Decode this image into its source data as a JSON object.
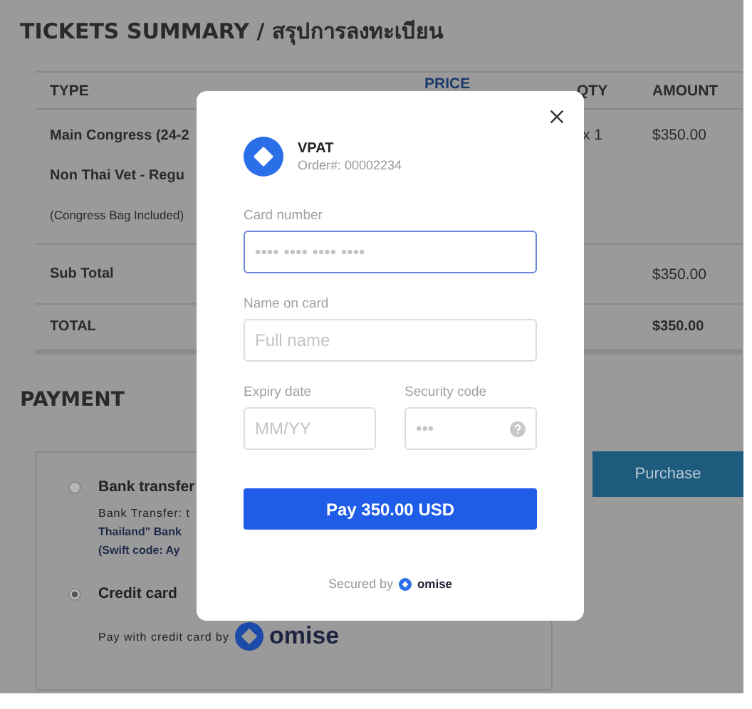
{
  "page": {
    "title": "TICKETS SUMMARY / สรุปการลงทะเบียน",
    "table": {
      "columns": [
        "TYPE",
        "PRICE",
        "QTY",
        "AMOUNT"
      ],
      "rows": [
        {
          "kind": "item",
          "type": "Main Congress (24-2",
          "qty": "x 1",
          "amount": "$350.00"
        },
        {
          "kind": "item",
          "type": "Non Thai Vet - Regu"
        },
        {
          "kind": "note",
          "type": "(Congress Bag Included)"
        }
      ],
      "subtotal": {
        "label": "Sub Total",
        "amount": "$350.00"
      },
      "total": {
        "label": "TOTAL",
        "amount": "$350.00"
      }
    },
    "payment": {
      "heading": "PAYMENT",
      "options": [
        {
          "label": "Bank transfer",
          "selected": false,
          "details": [
            {
              "text": "Bank Transfer: t",
              "bold": false
            },
            {
              "text": "Thailand\" Bank",
              "bold": true
            },
            {
              "text": "(Swift code: Ay",
              "bold": true
            }
          ]
        },
        {
          "label": "Credit card",
          "selected": true,
          "details": [
            {
              "text": "Pay with credit card by",
              "bold": false
            }
          ],
          "brand": "omise"
        }
      ],
      "purchase_button": "Purchase"
    }
  },
  "modal": {
    "merchant": "VPAT",
    "order": "Order#: 00002234",
    "fields": [
      {
        "label": "Card number",
        "placeholder": "•••• •••• •••• ••••",
        "focused": true,
        "kind": "wide"
      },
      {
        "label": "Name on card",
        "placeholder": "Full name",
        "focused": false,
        "kind": "wide"
      },
      {
        "label": "Expiry date",
        "placeholder": "MM/YY",
        "focused": false,
        "kind": "narrow"
      },
      {
        "label": "Security code",
        "placeholder": "•••",
        "focused": false,
        "kind": "narrow",
        "help": true
      }
    ],
    "pay_button": "Pay 350.00 USD",
    "footer": "Secured by",
    "footer_brand": "omise"
  }
}
